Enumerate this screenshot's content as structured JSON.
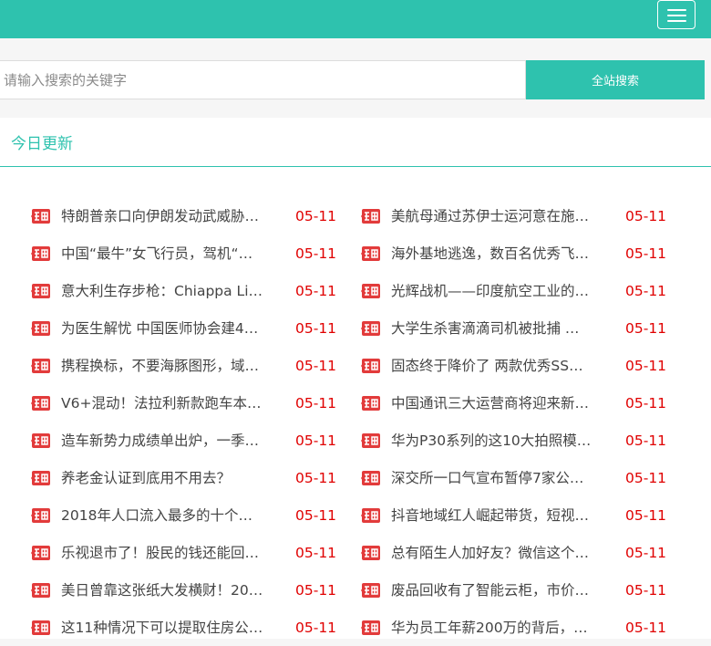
{
  "header": {
    "menu_icon": "hamburger-menu-icon",
    "brand_color": "#2ec2ae"
  },
  "search": {
    "placeholder": "请输入搜索的关键字",
    "button_label": "全站搜索"
  },
  "section": {
    "title": "今日更新"
  },
  "news_icon": "new-badge-icon",
  "news_left": [
    {
      "title": "特朗普亲口向伊朗发动武威胁…",
      "date": "05-11"
    },
    {
      "title": "中国“最牛”女飞行员，驾机“闯…",
      "date": "05-11"
    },
    {
      "title": "意大利生存步枪：Chiappa Lit…",
      "date": "05-11"
    },
    {
      "title": "为医生解忧 中国医师协会建4…",
      "date": "05-11"
    },
    {
      "title": "携程换标，不要海豚图形，域…",
      "date": "05-11"
    },
    {
      "title": "V6+混动！法拉利新款跑车本…",
      "date": "05-11"
    },
    {
      "title": "造车新势力成绩单出炉，一季…",
      "date": "05-11"
    },
    {
      "title": "养老金认证到底用不用去？",
      "date": "05-11"
    },
    {
      "title": "2018年人口流入最多的十个…",
      "date": "05-11"
    },
    {
      "title": "乐视退市了！股民的钱还能回…",
      "date": "05-11"
    },
    {
      "title": "美日曾靠这张纸大发横财！20…",
      "date": "05-11"
    },
    {
      "title": "这11种情况下可以提取住房公…",
      "date": "05-11"
    }
  ],
  "news_right": [
    {
      "title": "美航母通过苏伊士运河意在施…",
      "date": "05-11"
    },
    {
      "title": "海外基地逃逸，数百名优秀飞…",
      "date": "05-11"
    },
    {
      "title": "光辉战机——印度航空工业的…",
      "date": "05-11"
    },
    {
      "title": "大学生杀害滴滴司机被批捕 …",
      "date": "05-11"
    },
    {
      "title": "固态终于降价了 两款优秀SS…",
      "date": "05-11"
    },
    {
      "title": "中国通讯三大运营商将迎来新…",
      "date": "05-11"
    },
    {
      "title": "华为P30系列的这10大拍照模…",
      "date": "05-11"
    },
    {
      "title": "深交所一口气宣布暂停7家公…",
      "date": "05-11"
    },
    {
      "title": "抖音地域红人崛起带货，短视…",
      "date": "05-11"
    },
    {
      "title": "总有陌生人加好友？微信这个…",
      "date": "05-11"
    },
    {
      "title": "废品回收有了智能云柜，市价…",
      "date": "05-11"
    },
    {
      "title": "华为员工年薪200万的背后，…",
      "date": "05-11"
    }
  ]
}
